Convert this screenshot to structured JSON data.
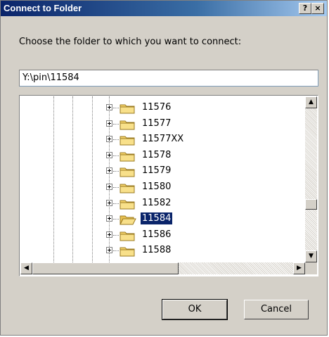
{
  "window": {
    "title": "Connect to Folder",
    "help_label": "?",
    "close_label": "×"
  },
  "prompt": "Choose the folder to which you want to connect:",
  "path_value": "Y:\\pin\\11584",
  "tree": {
    "items": [
      {
        "label": "11576",
        "selected": false
      },
      {
        "label": "11577",
        "selected": false
      },
      {
        "label": "11577XX",
        "selected": false
      },
      {
        "label": "11578",
        "selected": false
      },
      {
        "label": "11579",
        "selected": false
      },
      {
        "label": "11580",
        "selected": false
      },
      {
        "label": "11582",
        "selected": false
      },
      {
        "label": "11584",
        "selected": true
      },
      {
        "label": "11586",
        "selected": false
      },
      {
        "label": "11588",
        "selected": false
      }
    ]
  },
  "buttons": {
    "ok": "OK",
    "cancel": "Cancel"
  },
  "icons": {
    "folder": "folder-icon",
    "expand": "plus-expander-icon",
    "scroll_up": "arrow-up-icon",
    "scroll_down": "arrow-down-icon",
    "scroll_left": "arrow-left-icon",
    "scroll_right": "arrow-right-icon"
  },
  "colors": {
    "title_bar": "#0a246a",
    "selection": "#0a246a",
    "dialog_bg": "#d4d0c8",
    "folder": "#f5d46b"
  }
}
